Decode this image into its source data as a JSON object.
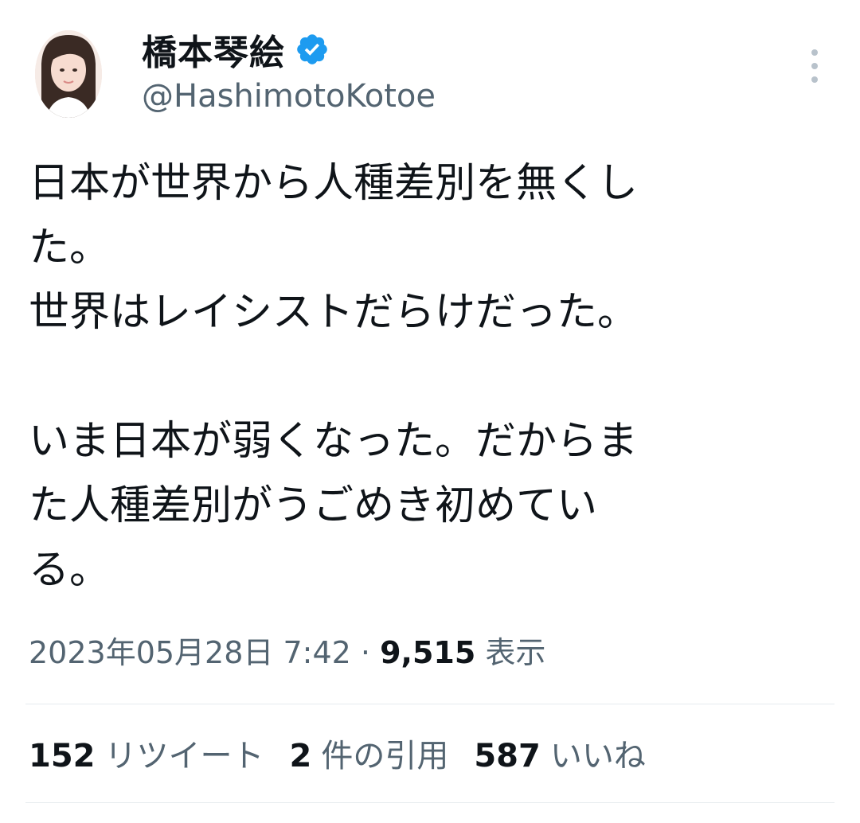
{
  "author": {
    "display_name": "橋本琴絵",
    "handle": "@HashimotoKotoe",
    "verified": true
  },
  "tweet": {
    "lines": [
      "日本が世界から人種差別を無くし",
      "た。",
      "世界はレイシストだらけだった。",
      "",
      "いま日本が弱くなった。だからま",
      "た人種差別がうごめき初めてい",
      "る。"
    ],
    "timestamp": "2023年05月28日 7:42",
    "separator": "·",
    "views_count": "9,515",
    "views_label": "表示"
  },
  "stats": {
    "retweets_count": "152",
    "retweets_label": "リツイート",
    "quotes_count": "2",
    "quotes_label": "件の引用",
    "likes_count": "587",
    "likes_label": "いいね"
  },
  "icons": {
    "verified": "verified-badge-icon",
    "more": "more-options-icon"
  },
  "colors": {
    "verified_blue": "#1d9bf0",
    "secondary_text": "#536471",
    "primary_text": "#0f1419",
    "divider": "#e6ebee"
  }
}
